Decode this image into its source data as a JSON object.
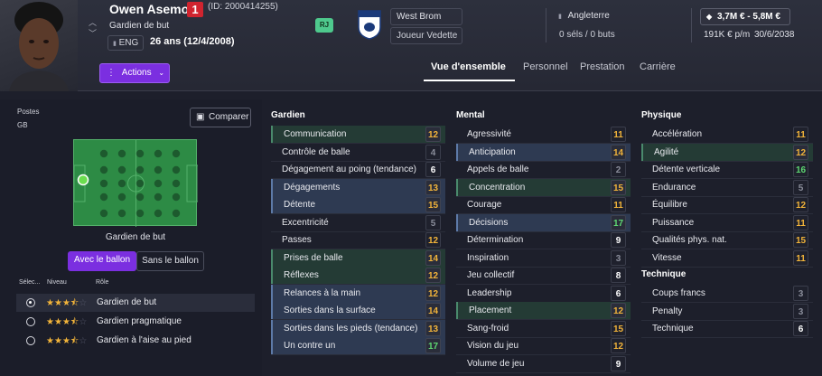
{
  "player": {
    "name": "Owen Asemota",
    "number": "1",
    "id": "(ID: 2000414255)",
    "position_label": "Gardien de but",
    "nationality": "ENG",
    "age": "26 ans (12/4/2008)",
    "foot": "RJ"
  },
  "club": {
    "name": "West Brom",
    "status": "Joueur Vedette"
  },
  "international": {
    "country": "Angleterre",
    "caps": "0 séls / 0 buts"
  },
  "finance": {
    "value": "3,7M € - 5,8M €",
    "wage": "191K € p/m",
    "contract": "30/6/2038"
  },
  "actions_label": "Actions",
  "tabs": [
    "Vue d'ensemble",
    "Personnel",
    "Prestation",
    "Carrière"
  ],
  "left": {
    "postes_label": "Postes",
    "postes_value": "GB",
    "compare_label": "Comparer",
    "pitch_caption": "Gardien de but",
    "with_ball": "Avec le ballon",
    "without_ball": "Sans le ballon",
    "col_sel": "Sélec...",
    "col_level": "Niveau",
    "col_role": "Rôle",
    "roles": [
      {
        "name": "Gardien de but",
        "stars": 3.5,
        "selected": true
      },
      {
        "name": "Gardien pragmatique",
        "stars": 3.5,
        "selected": false
      },
      {
        "name": "Gardien à l'aise au pied",
        "stars": 3.5,
        "selected": false
      }
    ]
  },
  "colors": {
    "accent": "#7b2fe0",
    "pitch": "#2d8b45",
    "high": "#5ed872",
    "mid": "#f2b43a"
  },
  "sections": {
    "gardien": {
      "title": "Gardien",
      "items": [
        {
          "name": "Communication",
          "value": "12"
        },
        {
          "name": "Contrôle de balle",
          "value": "4"
        },
        {
          "name": "Dégagement au poing (tendance)",
          "value": "6"
        },
        {
          "name": "Dégagements",
          "value": "13"
        },
        {
          "name": "Détente",
          "value": "15"
        },
        {
          "name": "Excentricité",
          "value": "5"
        },
        {
          "name": "Passes",
          "value": "12"
        },
        {
          "name": "Prises de balle",
          "value": "14"
        },
        {
          "name": "Réflexes",
          "value": "12"
        },
        {
          "name": "Relances à la main",
          "value": "12"
        },
        {
          "name": "Sorties dans la surface",
          "value": "14"
        },
        {
          "name": "Sorties dans les pieds (tendance)",
          "value": "13"
        },
        {
          "name": "Un contre un",
          "value": "17"
        }
      ]
    },
    "mental": {
      "title": "Mental",
      "items": [
        {
          "name": "Agressivité",
          "value": "11"
        },
        {
          "name": "Anticipation",
          "value": "14"
        },
        {
          "name": "Appels de balle",
          "value": "2"
        },
        {
          "name": "Concentration",
          "value": "15"
        },
        {
          "name": "Courage",
          "value": "11"
        },
        {
          "name": "Décisions",
          "value": "17"
        },
        {
          "name": "Détermination",
          "value": "9"
        },
        {
          "name": "Inspiration",
          "value": "3"
        },
        {
          "name": "Jeu collectif",
          "value": "8"
        },
        {
          "name": "Leadership",
          "value": "6"
        },
        {
          "name": "Placement",
          "value": "12"
        },
        {
          "name": "Sang-froid",
          "value": "15"
        },
        {
          "name": "Vision du jeu",
          "value": "12"
        },
        {
          "name": "Volume de jeu",
          "value": "9"
        }
      ]
    },
    "physique": {
      "title": "Physique",
      "items": [
        {
          "name": "Accélération",
          "value": "11"
        },
        {
          "name": "Agilité",
          "value": "12"
        },
        {
          "name": "Détente verticale",
          "value": "16"
        },
        {
          "name": "Endurance",
          "value": "5"
        },
        {
          "name": "Équilibre",
          "value": "12"
        },
        {
          "name": "Puissance",
          "value": "11"
        },
        {
          "name": "Qualités phys. nat.",
          "value": "15"
        },
        {
          "name": "Vitesse",
          "value": "11"
        }
      ]
    },
    "technique": {
      "title": "Technique",
      "items": [
        {
          "name": "Coups francs",
          "value": "3"
        },
        {
          "name": "Penalty",
          "value": "3"
        },
        {
          "name": "Technique",
          "value": "6"
        }
      ]
    }
  }
}
